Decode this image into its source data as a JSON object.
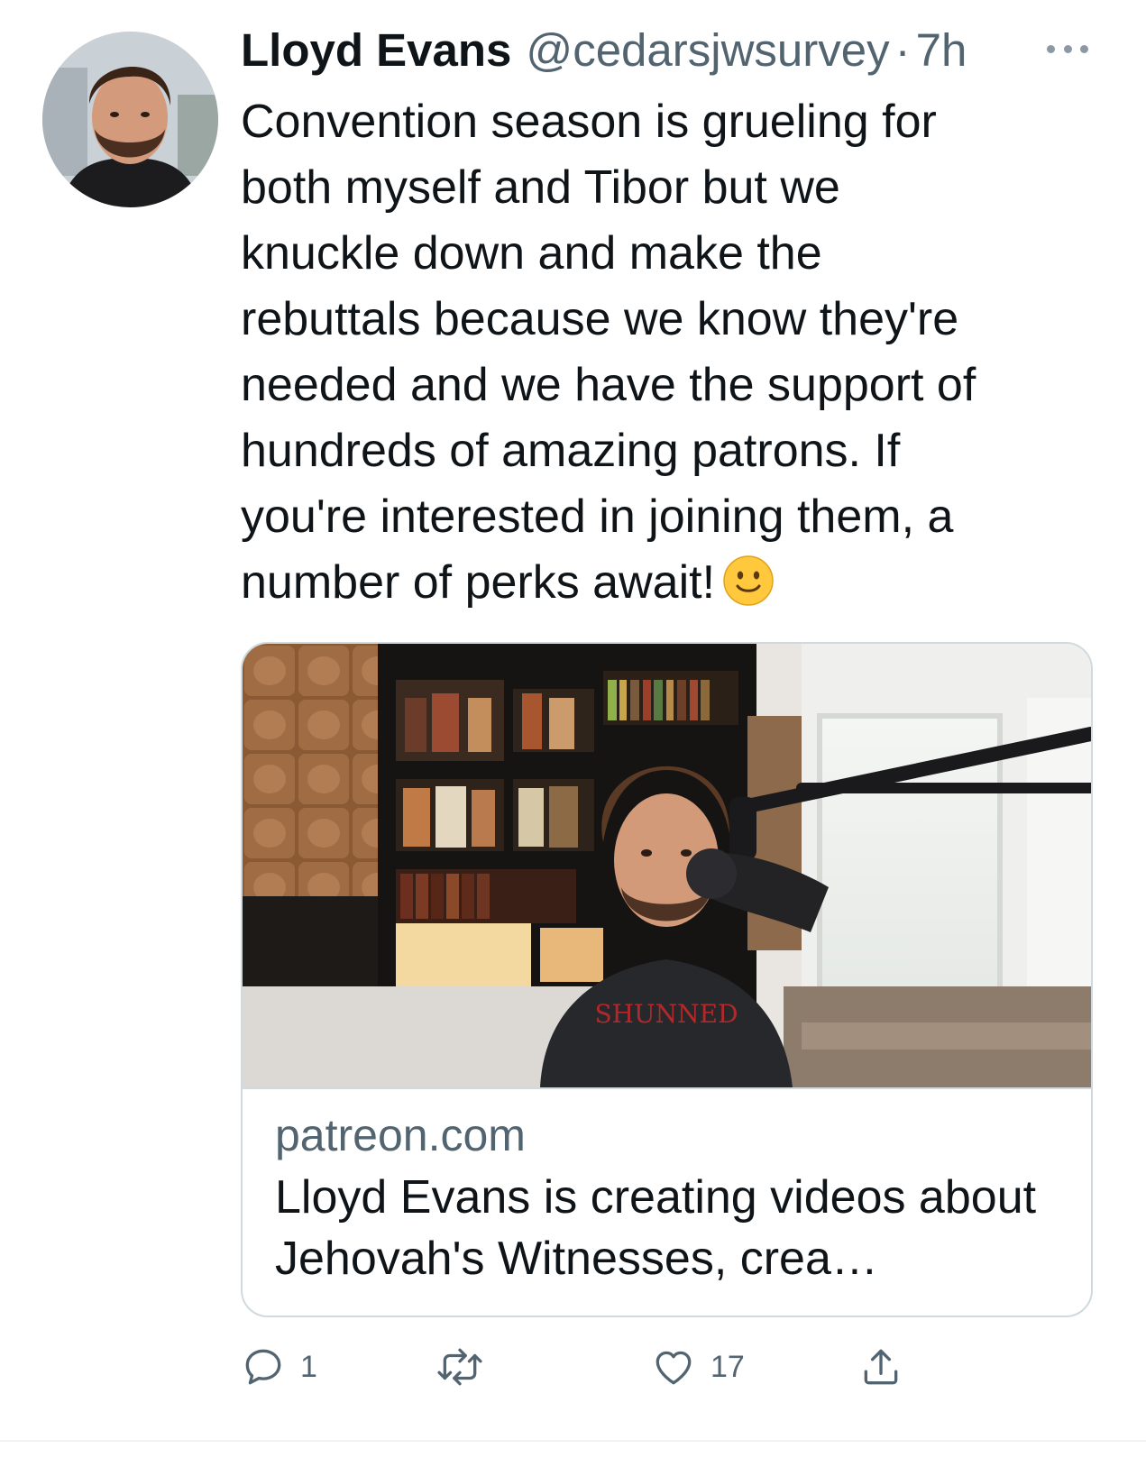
{
  "tweet": {
    "author": {
      "display_name": "Lloyd Evans",
      "handle": "@cedarsjwsurvey",
      "separator": "·",
      "time": "7h",
      "avatar_icon": "profile-photo"
    },
    "text": "Convention season is grueling for\nboth myself and Tibor but we\nknuckle down and make the\nrebuttals because we know they're\nneeded and we have the support of\nhundreds of amazing patrons. If\nyou're interested in joining them, a\nnumber of perks await!",
    "emoji": "slightly-smiling-face-emoji",
    "card": {
      "domain": "patreon.com",
      "title": "Lloyd Evans is creating videos about Jehovah's Witnesses, crea…",
      "image": "man-at-microphone-in-study-photo",
      "shirt_text": "SHUNNED"
    },
    "actions": {
      "reply": {
        "icon": "reply-icon",
        "count": "1"
      },
      "retweet": {
        "icon": "retweet-icon",
        "count": ""
      },
      "like": {
        "icon": "heart-icon",
        "count": "17"
      },
      "share": {
        "icon": "share-icon"
      }
    },
    "more_icon": "more-options-icon"
  },
  "colors": {
    "text_primary": "#0f1419",
    "text_secondary": "#536471",
    "border": "#cfd9de",
    "emoji_yellow": "#ffc83d"
  }
}
